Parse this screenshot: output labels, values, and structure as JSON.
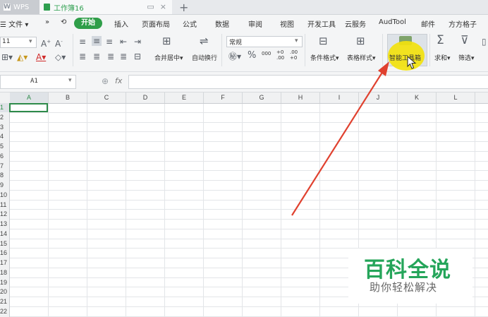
{
  "titlebar": {
    "wps_tab": "WPS",
    "doc_tab": "工作簿16",
    "close_glyph": "×",
    "restore_glyph": "▭",
    "new_tab": "+"
  },
  "menu": {
    "left_items": [
      "☰ 文件 ▾",
      "»",
      "A",
      "⟲"
    ],
    "start": "开始",
    "items": [
      "插入",
      "页面布局",
      "公式",
      "数据",
      "审阅",
      "视图",
      "开发工具",
      "云服务",
      "AudTool",
      "邮件",
      "方方格子"
    ]
  },
  "ribbon": {
    "font_size": "11",
    "number_format": "常规",
    "merge_center": "合并居中▾",
    "wrap_text": "自动换行",
    "cond_format": "条件格式▾",
    "table_style": "表格样式▾",
    "smart_toolbox": "智能工具箱",
    "sum": "求和▾",
    "filter": "筛选▾",
    "percent": "%",
    "thousands": "000",
    "inc_decimal": "+0 .00",
    "dec_decimal": ".00 +0"
  },
  "formula_bar": {
    "cell_ref": "A1",
    "fx": "fx"
  },
  "grid": {
    "columns": [
      "A",
      "B",
      "C",
      "D",
      "E",
      "F",
      "G",
      "H",
      "I",
      "J",
      "K",
      "L"
    ],
    "rows": [
      "1",
      "2",
      "3",
      "4",
      "5",
      "6",
      "7",
      "8",
      "9",
      "10",
      "11",
      "12",
      "13",
      "14",
      "15",
      "16",
      "17",
      "18",
      "19",
      "20",
      "21",
      "22"
    ]
  },
  "watermark": {
    "main": "百科全说",
    "sub": "助你轻松解决"
  },
  "colors": {
    "accent": "#2f9e49",
    "highlight": "#f2e20e",
    "arrow": "#e0412f"
  }
}
